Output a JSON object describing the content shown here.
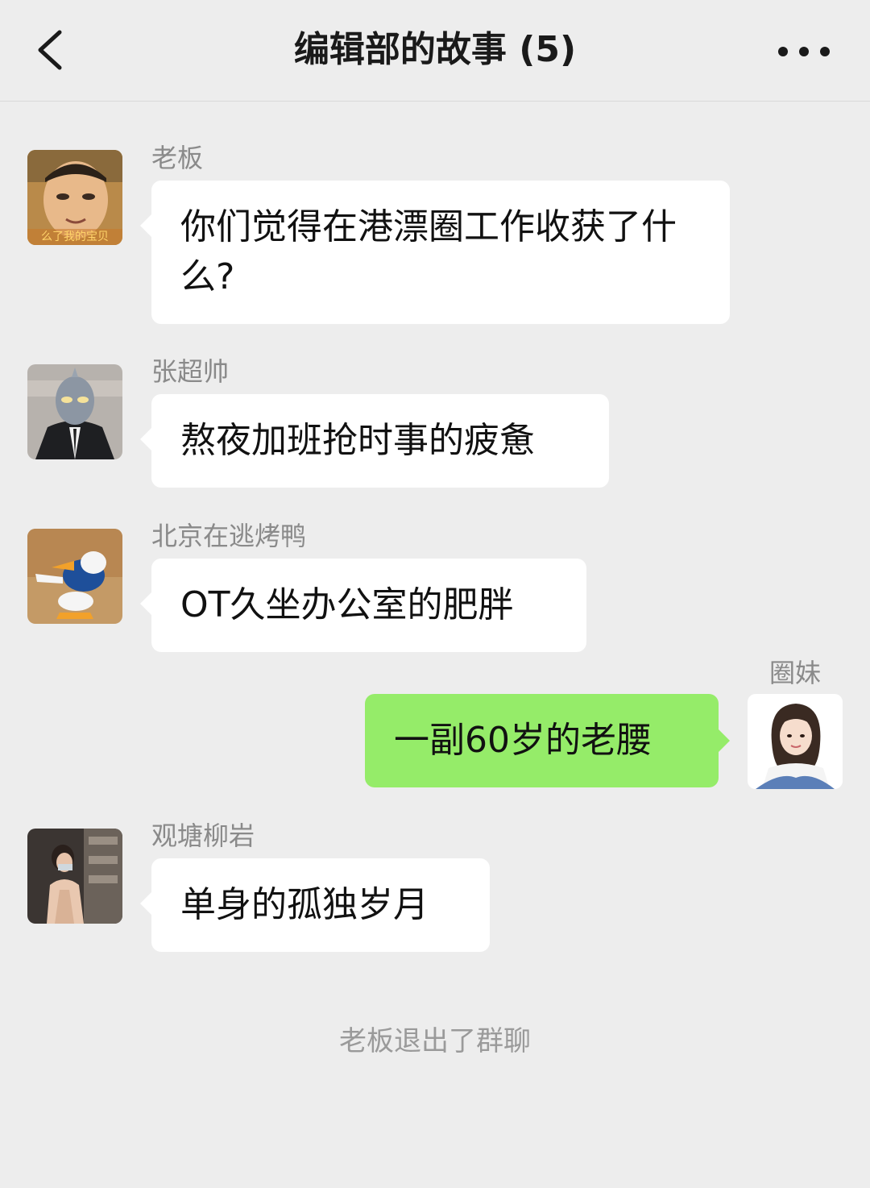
{
  "header": {
    "title": "编辑部的故事 (5)",
    "back_icon": "chevron-left-icon",
    "more_icon": "more-dots-icon"
  },
  "messages": [
    {
      "sender": "老板",
      "text": "你们觉得在港漂圈工作收获了什么?",
      "side": "left",
      "avatar_caption": "么了我的宝贝"
    },
    {
      "sender": "张超帅",
      "text": "熬夜加班抢时事的疲惫",
      "side": "left"
    },
    {
      "sender": "北京在逃烤鸭",
      "text": "OT久坐办公室的肥胖",
      "side": "left"
    },
    {
      "sender": "圈妹",
      "text": "一副60岁的老腰",
      "side": "right"
    },
    {
      "sender": "观塘柳岩",
      "text": "单身的孤独岁月",
      "side": "left"
    }
  ],
  "system_message": "老板退出了群聊",
  "colors": {
    "background": "#ededed",
    "bubble_left": "#ffffff",
    "bubble_right": "#95ec69"
  }
}
